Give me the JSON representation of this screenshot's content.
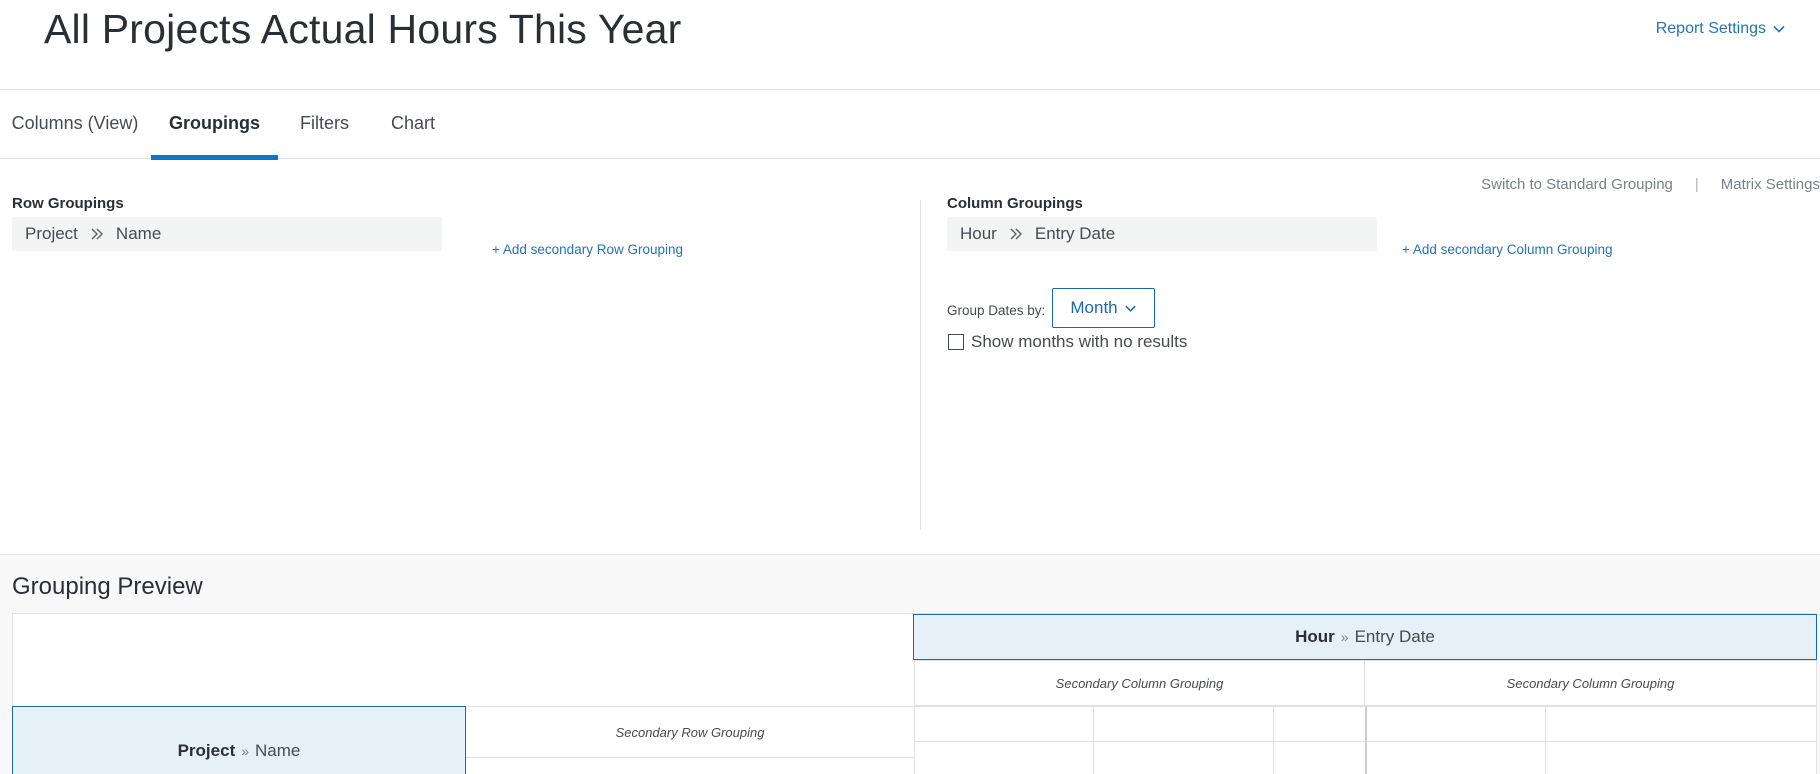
{
  "header": {
    "title": "All Projects Actual Hours This Year",
    "report_settings": "Report Settings"
  },
  "tabs": [
    {
      "label": "Columns (View)",
      "active": false
    },
    {
      "label": "Groupings",
      "active": true
    },
    {
      "label": "Filters",
      "active": false
    },
    {
      "label": "Chart",
      "active": false
    }
  ],
  "switch_links": {
    "standard": "Switch to Standard Grouping",
    "separator": "|",
    "matrix": "Matrix Settings"
  },
  "row_groupings": {
    "label": "Row Groupings",
    "field_object": "Project",
    "field_name": "Name",
    "add_link": "+ Add secondary Row Grouping"
  },
  "column_groupings": {
    "label": "Column Groupings",
    "field_object": "Hour",
    "field_name": "Entry Date",
    "add_link": "+ Add secondary Column Grouping",
    "group_dates_label": "Group Dates by:",
    "group_dates_value": "Month",
    "show_empty_label": "Show months with no results",
    "show_empty_checked": false
  },
  "preview": {
    "title": "Grouping Preview",
    "column_header_object": "Hour",
    "column_header_field": "Entry Date",
    "secondary_column_label": "Secondary Column Grouping",
    "secondary_row_label": "Secondary Row Grouping",
    "row_header_object": "Project",
    "row_header_field": "Name",
    "separator": "»"
  },
  "colors": {
    "accent": "#0d77c6",
    "link": "#2a72ad",
    "header_fill": "#e6f0f9",
    "header_border": "#1b6aa6"
  },
  "icons": {
    "report_settings": "chevron-down-icon",
    "grouping_separator": "double-chevron-right-icon",
    "month_dropdown": "chevron-down-icon"
  }
}
